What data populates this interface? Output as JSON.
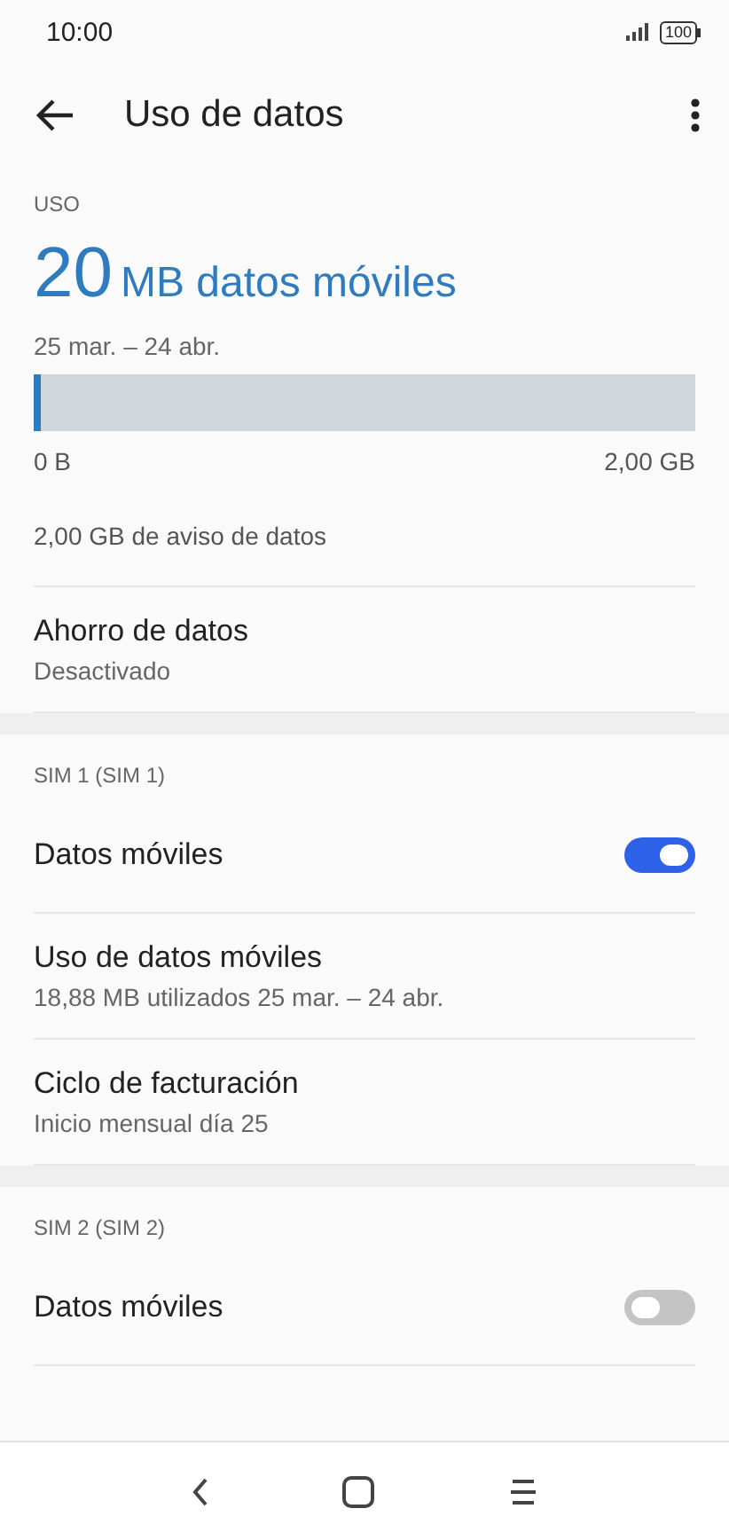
{
  "status_bar": {
    "time": "10:00",
    "battery": "100"
  },
  "app_bar": {
    "title": "Uso de datos"
  },
  "usage": {
    "header": "USO",
    "amount": "20",
    "unit": "MB datos móviles",
    "period": "25 mar. – 24 abr.",
    "level": 0.01,
    "min_label": "0 B",
    "max_label": "2,00 GB",
    "warning": "2,00 GB de aviso de datos"
  },
  "sections": [
    {
      "items": [
        {
          "kind": "text",
          "title": "Ahorro de datos",
          "subtitle": "Desactivado"
        }
      ]
    },
    {
      "header": "SIM 1 (SIM 1)",
      "items": [
        {
          "kind": "switch",
          "title": "Datos móviles",
          "on": true
        },
        {
          "kind": "text",
          "title": "Uso de datos móviles",
          "subtitle": "18,88 MB utilizados 25 mar. – 24 abr."
        },
        {
          "kind": "text",
          "title": "Ciclo de facturación",
          "subtitle": "Inicio mensual día 25"
        }
      ]
    },
    {
      "header": "SIM 2 (SIM 2)",
      "items": [
        {
          "kind": "switch",
          "title": "Datos móviles",
          "on": false
        }
      ]
    }
  ]
}
